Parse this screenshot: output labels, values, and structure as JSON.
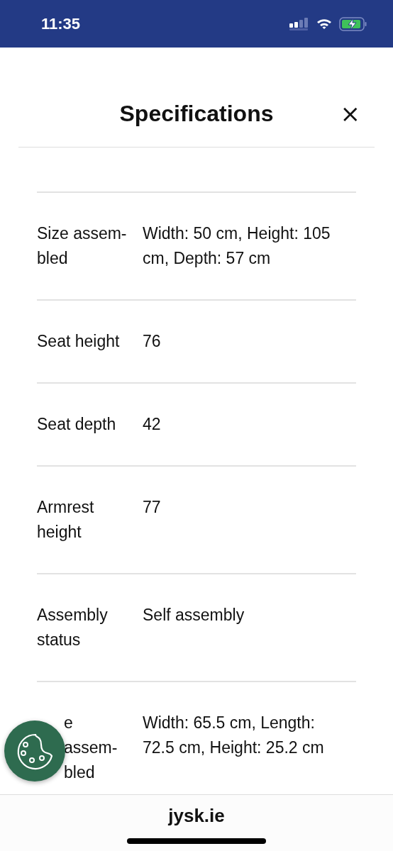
{
  "status_bar": {
    "time": "11:35"
  },
  "header": {
    "title": "Specifications",
    "close": "×"
  },
  "specs": [
    {
      "label_lines": [
        "Size assem-",
        "bled"
      ],
      "value_lines": [
        "Width: 50 cm, Height: 105",
        "cm, Depth: 57 cm"
      ],
      "covered": false
    },
    {
      "label_lines": [
        "Seat height"
      ],
      "value_lines": [
        "76"
      ],
      "covered": false
    },
    {
      "label_lines": [
        "Seat depth"
      ],
      "value_lines": [
        "42"
      ],
      "covered": false
    },
    {
      "label_lines": [
        "Armrest",
        "height"
      ],
      "value_lines": [
        "77"
      ],
      "covered": false
    },
    {
      "label_lines": [
        "Assembly",
        "status"
      ],
      "value_lines": [
        "Self assembly"
      ],
      "covered": false
    },
    {
      "label_lines": [
        "e",
        "assem-",
        "bled"
      ],
      "value_lines": [
        "Width: 65.5 cm, Length:",
        "72.5 cm, Height: 25.2 cm"
      ],
      "covered": true
    }
  ],
  "browser_bar": {
    "domain": "jysk.ie"
  }
}
